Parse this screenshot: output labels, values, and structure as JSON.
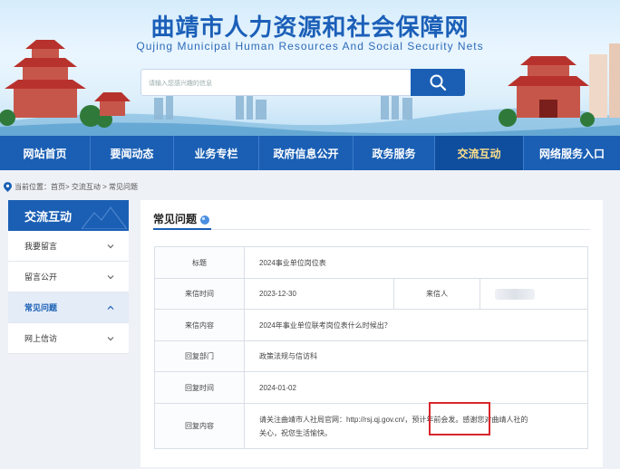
{
  "header": {
    "title": "曲靖市人力资源和社会保障网",
    "subtitle": "Qujing Municipal Human Resources And Social Security Nets",
    "search_placeholder": "请输入您感兴趣的信息",
    "search_icon": "search-icon"
  },
  "nav": {
    "items": [
      {
        "label": "网站首页"
      },
      {
        "label": "要闻动态"
      },
      {
        "label": "业务专栏"
      },
      {
        "label": "政府信息公开"
      },
      {
        "label": "政务服务"
      },
      {
        "label": "交流互动"
      },
      {
        "label": "网络服务入口"
      }
    ],
    "active": "交流互动"
  },
  "breadcrumb": "当前位置：首页> 交流互动 > 常见问题",
  "sidebar": {
    "heading": "交流互动",
    "items": [
      {
        "label": "我要留言",
        "icon": "chevron-down-icon"
      },
      {
        "label": "留言公开",
        "icon": "chevron-down-icon"
      },
      {
        "label": "常见问题",
        "icon": "chevron-up-icon"
      },
      {
        "label": "网上信访",
        "icon": "chevron-down-icon"
      }
    ]
  },
  "main": {
    "title": "常见问题",
    "rows": {
      "subject_label": "标题",
      "subject_value": "2024事业单位岗位表",
      "time_label": "来信时间",
      "time_value": "2023-12-30",
      "sender_label": "来信人",
      "content_label": "来信内容",
      "content_value": "2024年事业单位联考岗位表什么时候出？",
      "dept_label": "回复部门",
      "dept_value": "政策法规与信访科",
      "reply_time_label": "回复时间",
      "reply_time_value": "2024-01-02",
      "reply_label": "回复内容",
      "reply_value_line1": "请关注曲靖市人社局官网：http://rsj.qj.gov.cn/，预计年前会发。感谢您对曲靖人社的",
      "reply_value_line2": "关心，祝您生活愉快。"
    }
  },
  "colors": {
    "primary": "#1a5fb4",
    "active_nav_text": "#ffe08a",
    "highlight_box": "#d9262c"
  }
}
